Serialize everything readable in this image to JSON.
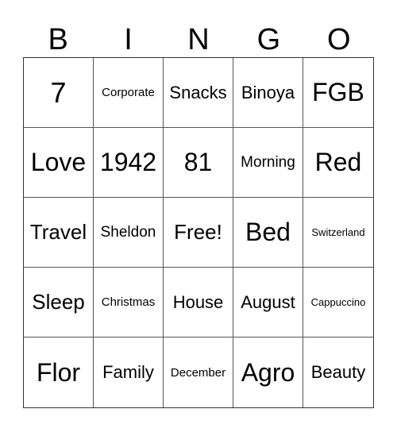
{
  "header": [
    "B",
    "I",
    "N",
    "G",
    "O"
  ],
  "cells": [
    [
      "7",
      "Corporate",
      "Snacks",
      "Binoya",
      "FGB"
    ],
    [
      "Love",
      "1942",
      "81",
      "Morning",
      "Red"
    ],
    [
      "Travel",
      "Sheldon",
      "Free!",
      "Bed",
      "Switzerland"
    ],
    [
      "Sleep",
      "Christmas",
      "House",
      "August",
      "Cappuccino"
    ],
    [
      "Flor",
      "Family",
      "December",
      "Agro",
      "Beauty"
    ]
  ]
}
